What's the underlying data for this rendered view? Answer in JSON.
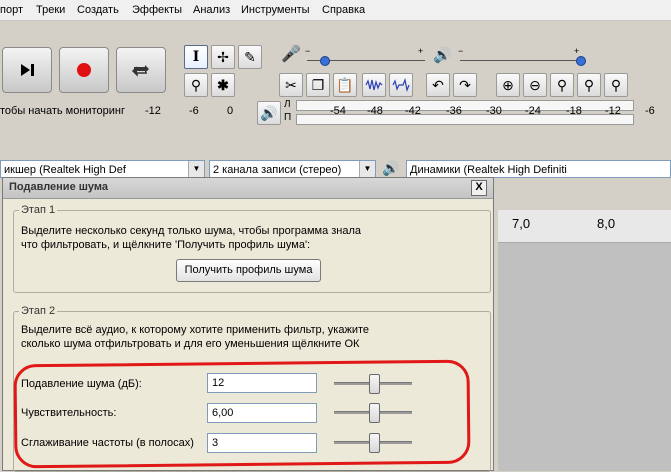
{
  "menu": {
    "items": [
      "порт",
      "Треки",
      "Создать",
      "Эффекты",
      "Анализ",
      "Инструменты",
      "Справка"
    ]
  },
  "meter": {
    "monitor_text": "тобы начать мониторинг",
    "record_ticks": [
      "-12",
      "-6",
      "0"
    ],
    "play_ticks": [
      "-54",
      "-48",
      "-42",
      "-36",
      "-30",
      "-24",
      "-18",
      "-12",
      "-6"
    ],
    "channel_l": "Л",
    "channel_r": "П"
  },
  "devices": {
    "recording_device": "икшер (Realtek High Def",
    "channels": "2  канала записи (стерео)",
    "playback_device": "Динамики (Realtek High Definiti"
  },
  "timeline": {
    "ticks": [
      "7,0",
      "8,0"
    ]
  },
  "dialog": {
    "title": "Подавление шума",
    "close_label": "X",
    "step1": {
      "title": "Этап 1",
      "description_line1": "Выделите несколько секунд только шума, чтобы программа знала",
      "description_line2": "что фильтровать, и щёлкните 'Получить профиль шума':",
      "button_label": "Получить профиль шума"
    },
    "step2": {
      "title": "Этап 2",
      "description_line1": "Выделите всё аудио, к которому хотите применить фильтр, укажите",
      "description_line2": "сколько шума отфильтровать и для его уменьшения щёлкните ОК",
      "noise_reduction_label": "Подавление шума (дБ):",
      "noise_reduction_value": "12",
      "noise_reduction_level": 0.5,
      "sensitivity_label": "Чувствительность:",
      "sensitivity_value": "6,00",
      "sensitivity_level": 0.5,
      "smoothing_label": "Сглаживание частоты (в полосах)",
      "smoothing_value": "3",
      "smoothing_level": 0.5
    }
  },
  "colors": {
    "highlight": "#e01818",
    "accent": "#3a6fd8",
    "record": "#e01010"
  }
}
